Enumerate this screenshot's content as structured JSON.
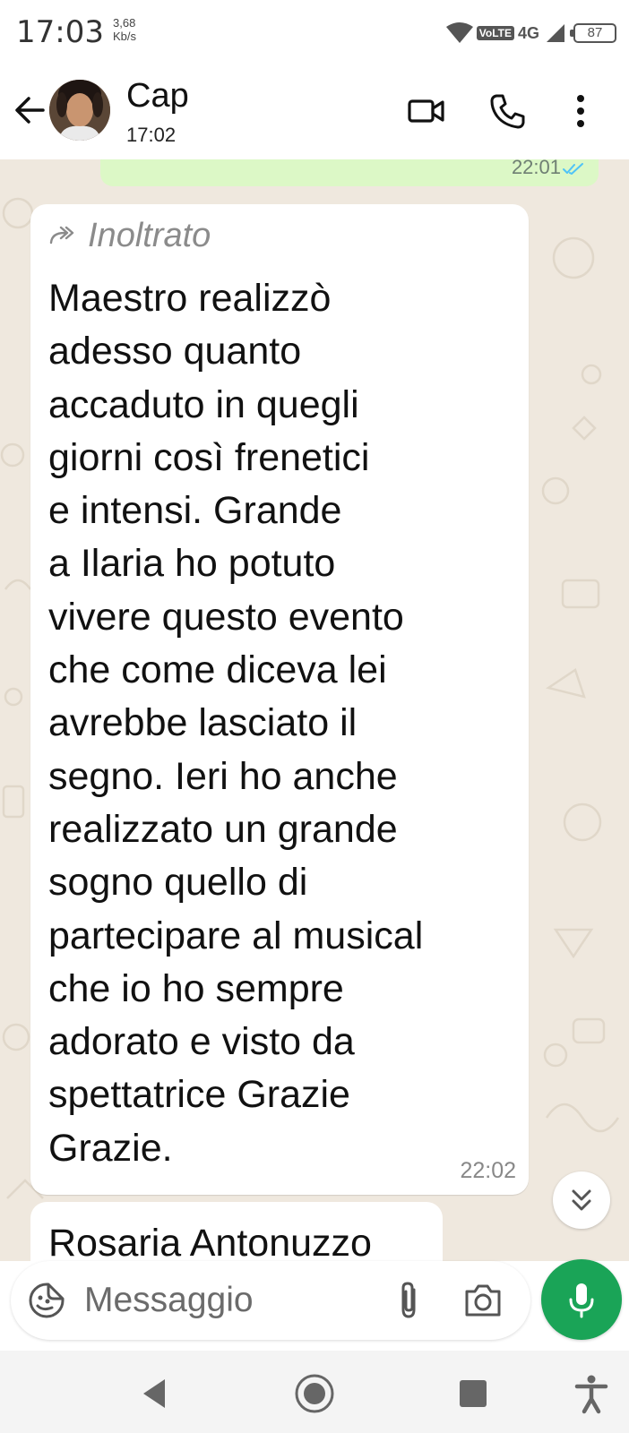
{
  "status_bar": {
    "time": "17:03",
    "speed_value": "3,68",
    "speed_unit": "Kb/s",
    "volte": "VoLTE",
    "network": "4G",
    "battery": "87"
  },
  "header": {
    "contact_name": "Cap",
    "last_seen": "17:02"
  },
  "chat": {
    "previous_message_time": "22:01",
    "message": {
      "forwarded_label": "Inoltrato",
      "text": "Maestro realizzò\nadesso quanto\naccaduto in quegli\ngiorni così frenetici\ne intensi. Grande\na Ilaria ho potuto\nvivere questo evento\nche come diceva lei\navrebbe lasciato il\nsegno. Ieri ho anche\nrealizzato un grande\nsogno quello di\npartecipare al musical\nche io ho sempre\nadorato e visto da\nspettatrice Grazie\nGrazie.",
      "time": "22:02"
    },
    "next_message_text": "Rosaria Antonuzzo"
  },
  "composer": {
    "placeholder": "Messaggio"
  },
  "icons": {
    "back": "arrow-left-icon",
    "video": "video-call-icon",
    "voice": "phone-icon",
    "menu": "more-vertical-icon",
    "forward": "forward-icon",
    "scroll": "chevron-double-down-icon",
    "emoji": "sticker-icon",
    "attach": "paperclip-icon",
    "camera": "camera-icon",
    "mic": "microphone-icon"
  },
  "colors": {
    "outgoing_bubble": "#dcf8c6",
    "chat_background": "#efe8de",
    "mic_button": "#1aa457",
    "read_ticks": "#4fc3f7"
  }
}
